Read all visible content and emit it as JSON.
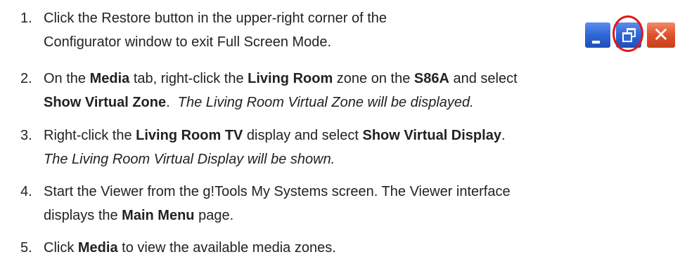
{
  "steps": [
    {
      "number": "1.",
      "lines": [
        [
          {
            "t": "Click the Restore button in the upper-right corner of the",
            "s": "normal"
          }
        ],
        [
          {
            "t": "Configurator window to exit Full Screen Mode.",
            "s": "normal"
          }
        ]
      ]
    },
    {
      "number": "2.",
      "lines": [
        [
          {
            "t": "On the ",
            "s": "normal"
          },
          {
            "t": "Media",
            "s": "bold"
          },
          {
            "t": " tab, right-click the ",
            "s": "normal"
          },
          {
            "t": "Living Room",
            "s": "bold"
          },
          {
            "t": " zone on the ",
            "s": "normal"
          },
          {
            "t": "S86A",
            "s": "bold"
          },
          {
            "t": " and select",
            "s": "normal"
          }
        ],
        [
          {
            "t": "Show Virtual Zone",
            "s": "bold"
          },
          {
            "t": ".  ",
            "s": "normal"
          },
          {
            "t": "The Living Room Virtual Zone will be displayed.",
            "s": "italic"
          }
        ]
      ]
    },
    {
      "number": "3.",
      "lines": [
        [
          {
            "t": "Right-click the ",
            "s": "normal"
          },
          {
            "t": "Living Room TV",
            "s": "bold"
          },
          {
            "t": " display and select ",
            "s": "normal"
          },
          {
            "t": "Show Virtual Display",
            "s": "bold"
          },
          {
            "t": ".",
            "s": "normal"
          }
        ],
        [
          {
            "t": "The Living Room Virtual Display will be shown.",
            "s": "italic"
          }
        ]
      ]
    },
    {
      "number": "4.",
      "lines": [
        [
          {
            "t": "Start the Viewer from the g!Tools My Systems screen. The Viewer interface",
            "s": "normal"
          }
        ],
        [
          {
            "t": "displays the ",
            "s": "normal"
          },
          {
            "t": "Main Menu",
            "s": "bold"
          },
          {
            "t": " page.",
            "s": "normal"
          }
        ]
      ]
    },
    {
      "number": "5.",
      "lines": [
        [
          {
            "t": "Click ",
            "s": "normal"
          },
          {
            "t": "Media",
            "s": "bold"
          },
          {
            "t": " to view the available media zones.",
            "s": "normal"
          }
        ]
      ]
    }
  ],
  "window_buttons": {
    "minimize_icon": "minimize-icon",
    "restore_icon": "restore-icon",
    "close_icon": "close-icon",
    "close_glyph": "✕",
    "highlight_color": "#e01818"
  }
}
